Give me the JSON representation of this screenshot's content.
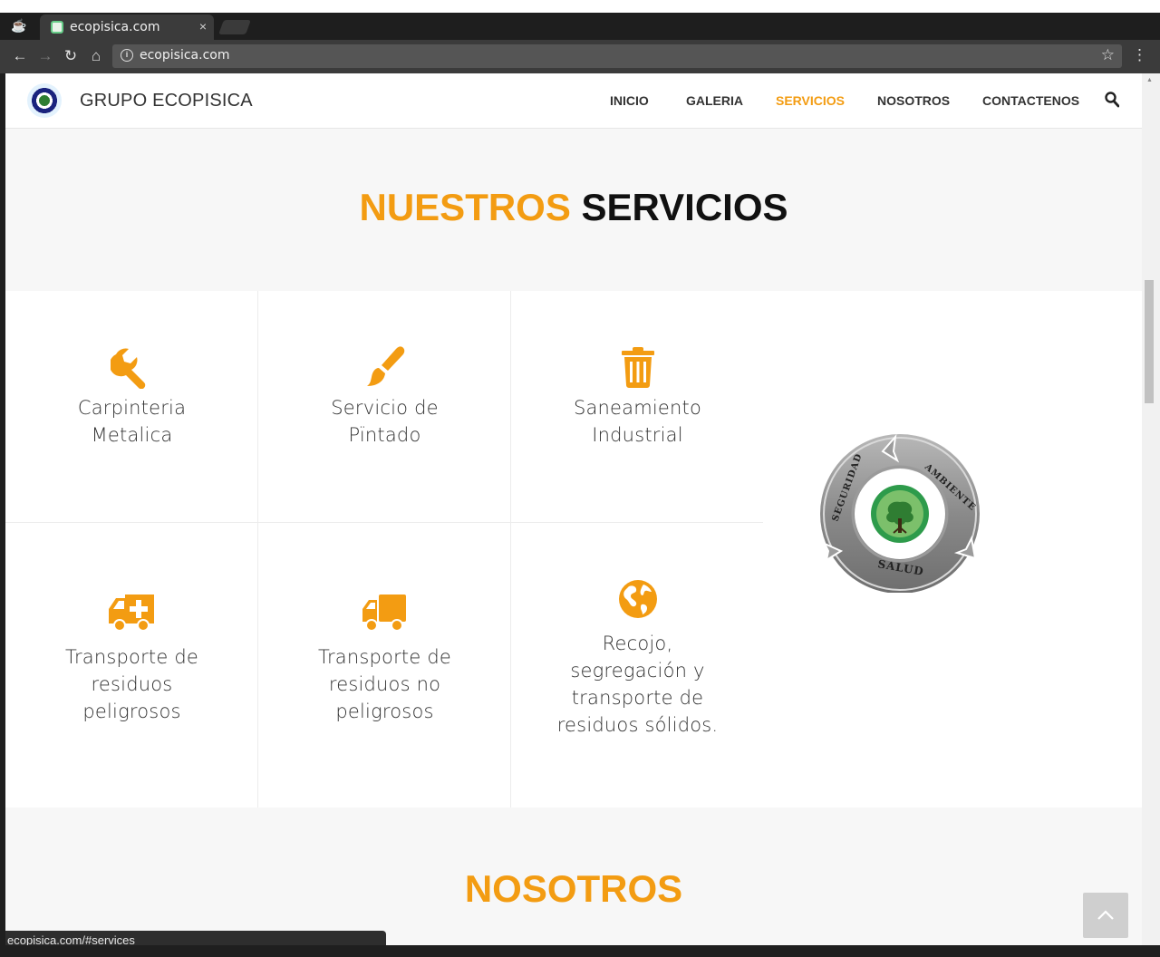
{
  "browser": {
    "tab_title": "ecopisica.com",
    "tab_close": "×",
    "url": "ecopisica.com",
    "status_url": "ecopisica.com/#services"
  },
  "site": {
    "brand": "GRUPO ECOPISICA",
    "nav": [
      "INICIO",
      "GALERIA",
      "SERVICIOS",
      "NOSOTROS",
      "CONTACTENOS"
    ],
    "active_nav": "SERVICIOS"
  },
  "services_section": {
    "title_accent": "NUESTROS",
    "title_rest": "SERVICIOS",
    "items": [
      {
        "icon": "wrench-icon",
        "label": [
          "Carpinteria",
          "Metalica"
        ]
      },
      {
        "icon": "paintbrush-icon",
        "label": [
          "Servicio de",
          "Pïntado"
        ]
      },
      {
        "icon": "trash-icon",
        "label": [
          "Saneamiento",
          "Industrial"
        ]
      },
      {
        "icon": "ambulance-icon",
        "label": [
          "Transporte de",
          "residuos",
          "peligrosos"
        ]
      },
      {
        "icon": "truck-icon",
        "label": [
          "Transporte de",
          "residuos no",
          "peligrosos"
        ]
      },
      {
        "icon": "globe-icon",
        "label": [
          "Recojo,",
          "segregación y",
          "transporte de",
          "residuos sólidos."
        ]
      }
    ],
    "badge_texts": {
      "top_left": "SEGURIDAD",
      "top_right": "AMBIENTE",
      "bottom": "SALUD"
    }
  },
  "about_section": {
    "title": "NOSOTROS"
  },
  "colors": {
    "accent": "#f39c12",
    "text_dark": "#111111"
  }
}
